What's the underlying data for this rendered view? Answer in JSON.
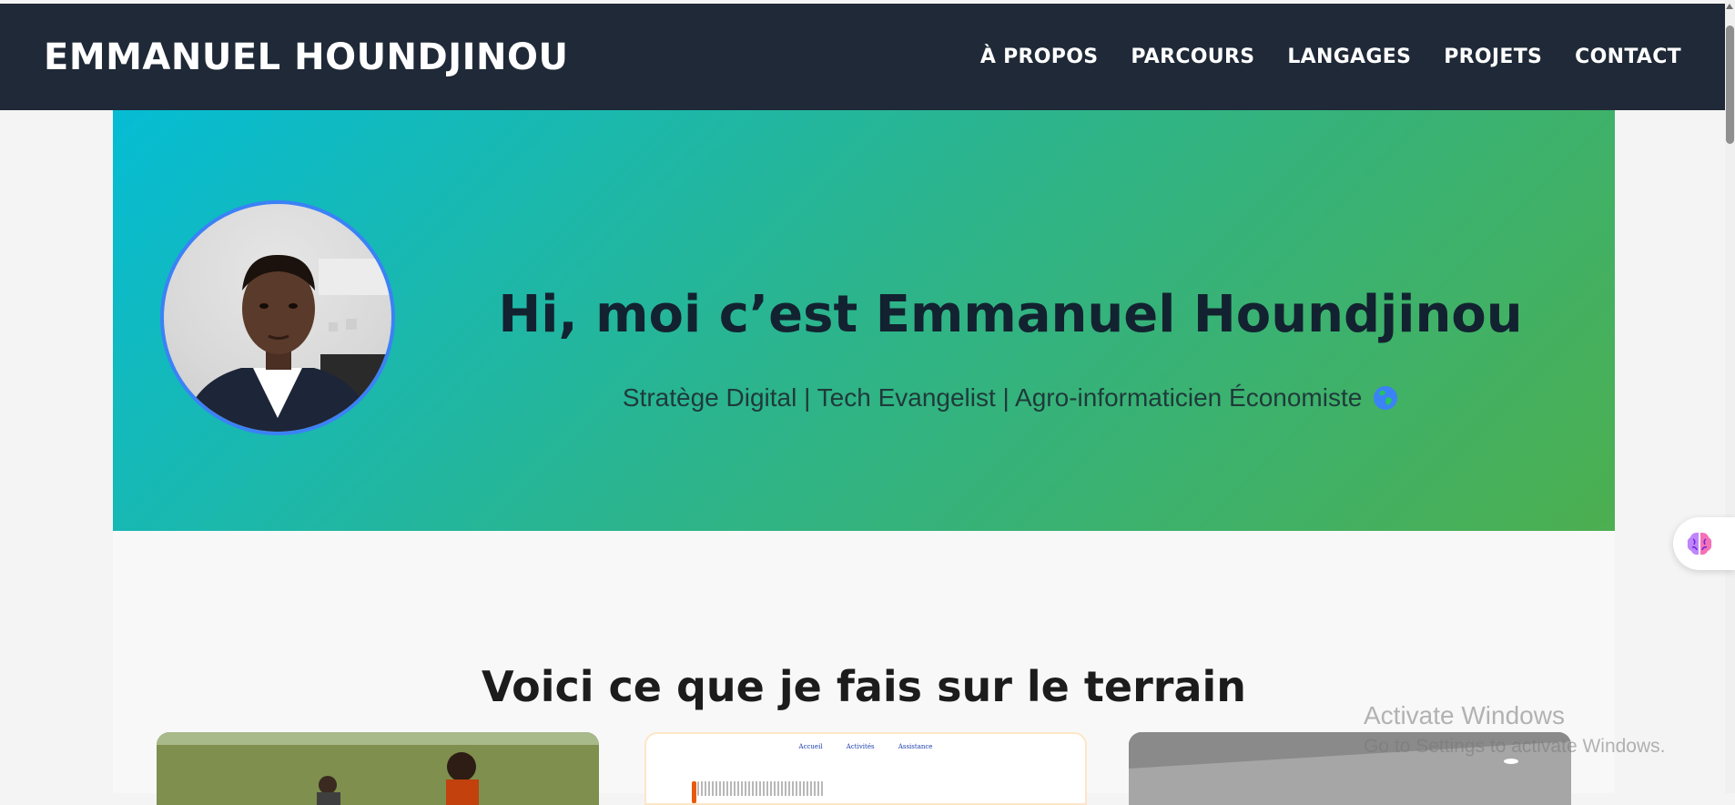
{
  "header": {
    "brand": "EMMANUEL HOUNDJINOU",
    "nav": [
      {
        "label": "À PROPOS"
      },
      {
        "label": "PARCOURS"
      },
      {
        "label": "LANGAGES"
      },
      {
        "label": "PROJETS"
      },
      {
        "label": "CONTACT"
      }
    ]
  },
  "hero": {
    "title": "Hi, moi c’est Emmanuel Houndjinou",
    "subtitle": "Stratège Digital | Tech Evangelist | Agro-informaticien Économiste",
    "subtitle_icon": "globe-icon",
    "avatar_icon": "profile-photo"
  },
  "terrain": {
    "title": "Voici ce que je fais sur le terrain",
    "cards": [
      {
        "icon": "field-photo"
      },
      {
        "icon": "document-screenshot",
        "mini_nav": [
          "Accueil",
          "Activités",
          "Assistance"
        ]
      },
      {
        "icon": "room-photo"
      }
    ]
  },
  "floating": {
    "icon": "brain-icon"
  },
  "system": {
    "watermark_title": "Activate Windows",
    "watermark_subtitle": "Go to Settings to activate Windows."
  },
  "colors": {
    "navbar": "#1f2937",
    "hero_start": "#06bcd4",
    "hero_end": "#4caf50",
    "avatar_border": "#3b82f6"
  }
}
